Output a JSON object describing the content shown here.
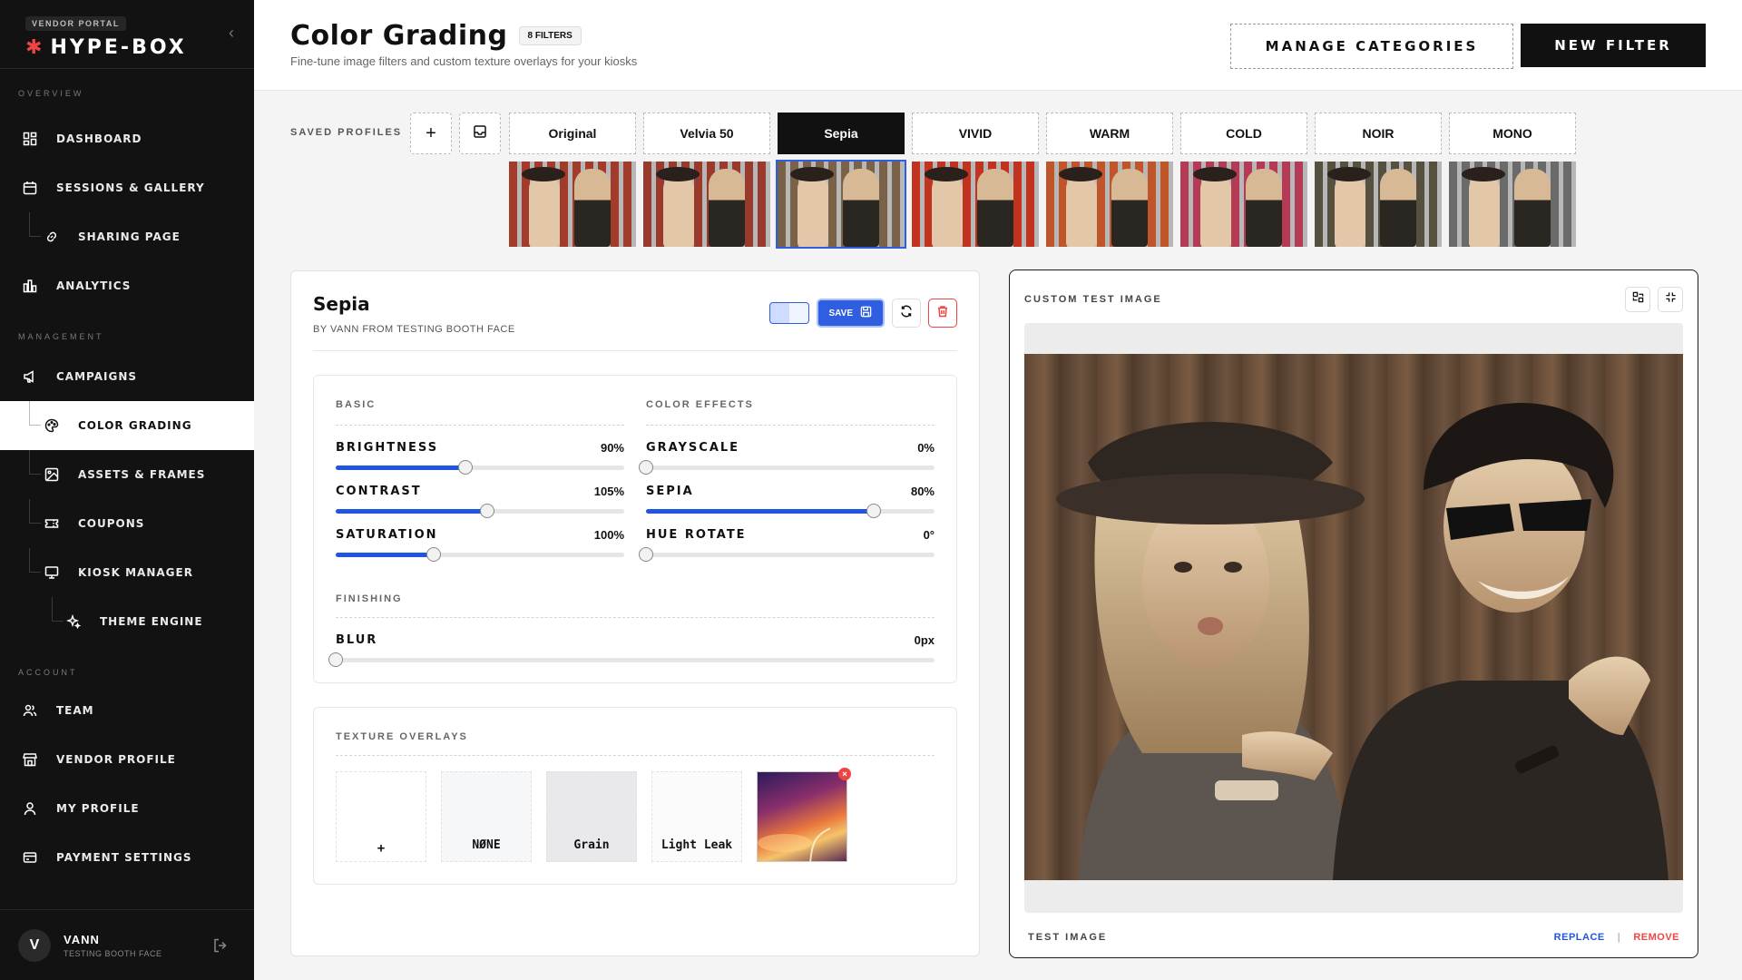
{
  "sidebar": {
    "portal_tag": "VENDOR PORTAL",
    "brand": "HYPE-BOX",
    "sections": {
      "overview": "OVERVIEW",
      "management": "MANAGEMENT",
      "account": "ACCOUNT"
    },
    "items": [
      {
        "label": "DASHBOARD",
        "icon": "grid-icon"
      },
      {
        "label": "SESSIONS & GALLERY",
        "icon": "calendar-icon"
      },
      {
        "label": "SHARING PAGE",
        "icon": "link-icon"
      },
      {
        "label": "ANALYTICS",
        "icon": "bar-chart-icon"
      },
      {
        "label": "CAMPAIGNS",
        "icon": "megaphone-icon"
      },
      {
        "label": "COLOR GRADING",
        "icon": "palette-icon"
      },
      {
        "label": "ASSETS & FRAMES",
        "icon": "image-icon"
      },
      {
        "label": "COUPONS",
        "icon": "ticket-icon"
      },
      {
        "label": "KIOSK MANAGER",
        "icon": "monitor-icon"
      },
      {
        "label": "THEME ENGINE",
        "icon": "sparkle-icon"
      },
      {
        "label": "TEAM",
        "icon": "users-icon"
      },
      {
        "label": "VENDOR PROFILE",
        "icon": "store-icon"
      },
      {
        "label": "MY PROFILE",
        "icon": "user-icon"
      },
      {
        "label": "PAYMENT SETTINGS",
        "icon": "credit-card-icon"
      }
    ],
    "user": {
      "initial": "V",
      "name": "VANN",
      "org": "TESTING BOOTH FACE"
    }
  },
  "header": {
    "title": "Color Grading",
    "badge": "8 FILTERS",
    "subtitle": "Fine-tune image filters and custom texture overlays for your kiosks",
    "manage_label": "MANAGE CATEGORIES",
    "new_label": "NEW FILTER"
  },
  "profiles": {
    "label": "SAVED PROFILES",
    "items": [
      {
        "name": "Original",
        "tint": "#a33b2a"
      },
      {
        "name": "Velvia 50",
        "tint": "#9a3a2c"
      },
      {
        "name": "Sepia",
        "tint": "#7a6248"
      },
      {
        "name": "VIVID",
        "tint": "#c2331f"
      },
      {
        "name": "WARM",
        "tint": "#c0552a"
      },
      {
        "name": "COLD",
        "tint": "#b43a55"
      },
      {
        "name": "NOIR",
        "tint": "#56503f"
      },
      {
        "name": "MONO",
        "tint": "#6a6a6a"
      }
    ],
    "selected": "Sepia"
  },
  "editor": {
    "name": "Sepia",
    "author": "BY VANN FROM TESTING BOOTH FACE",
    "save_label": "SAVE",
    "basic": {
      "label": "BASIC",
      "brightness": {
        "label": "BRIGHTNESS",
        "value": "90%",
        "fraction": 0.45
      },
      "contrast": {
        "label": "CONTRAST",
        "value": "105%",
        "fraction": 0.525
      },
      "saturation": {
        "label": "SATURATION",
        "value": "100%",
        "fraction": 0.34
      }
    },
    "color_effects": {
      "label": "COLOR EFFECTS",
      "grayscale": {
        "label": "GRAYSCALE",
        "value": "0%",
        "fraction": 0
      },
      "sepia": {
        "label": "SEPIA",
        "value": "80%",
        "fraction": 0.79
      },
      "hue_rotate": {
        "label": "HUE ROTATE",
        "value": "0°",
        "fraction": 0
      }
    },
    "finishing": {
      "label": "FINISHING",
      "blur": {
        "label": "BLUR",
        "value": "0px",
        "fraction": 0
      }
    },
    "textures": {
      "label": "TEXTURE OVERLAYS",
      "add": "+",
      "items": [
        "NØNE",
        "Grain",
        "Light Leak"
      ],
      "remove_mark": "×"
    }
  },
  "preview": {
    "label": "CUSTOM TEST IMAGE",
    "footer_label": "TEST IMAGE",
    "replace": "REPLACE",
    "separator": "|",
    "remove": "REMOVE"
  },
  "colors": {
    "accent": "#1f55e0",
    "danger": "#ef4444",
    "sidebar": "#121212"
  }
}
